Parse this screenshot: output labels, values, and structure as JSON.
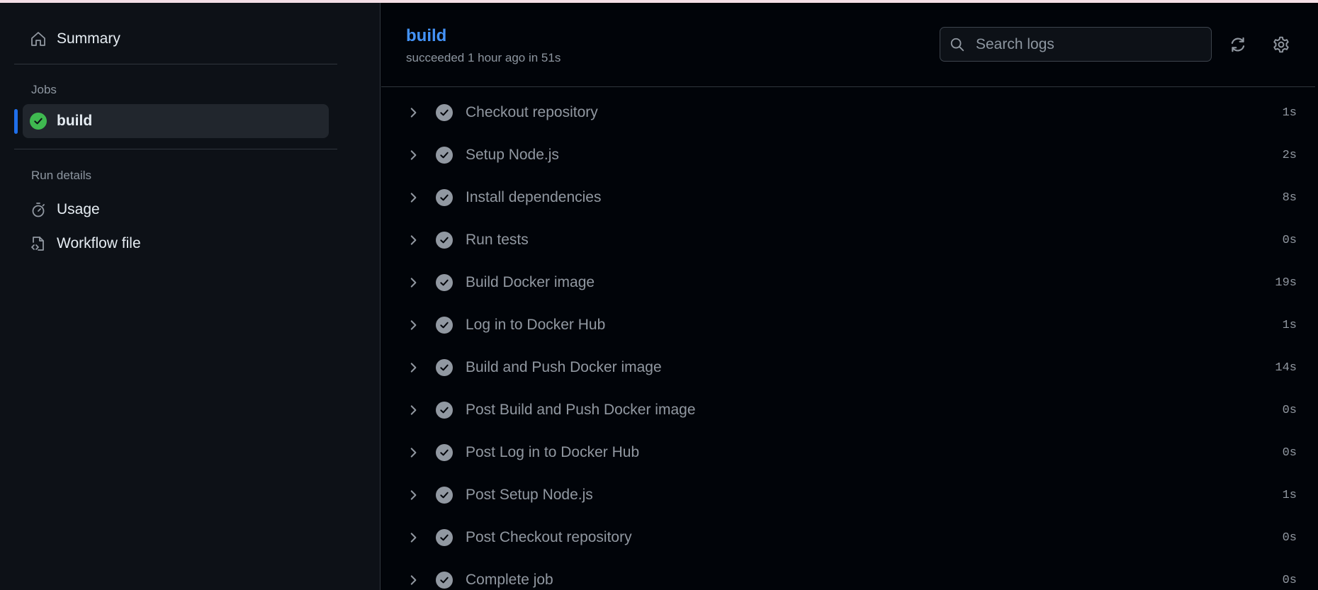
{
  "sidebar": {
    "summary_label": "Summary",
    "jobs_heading": "Jobs",
    "job": {
      "label": "build",
      "status": "success"
    },
    "run_details_heading": "Run details",
    "usage_label": "Usage",
    "workflow_file_label": "Workflow file"
  },
  "header": {
    "title": "build",
    "subtitle": "succeeded 1 hour ago in 51s",
    "search_placeholder": "Search logs"
  },
  "steps": [
    {
      "name": "Checkout repository",
      "duration": "1s"
    },
    {
      "name": "Setup Node.js",
      "duration": "2s"
    },
    {
      "name": "Install dependencies",
      "duration": "8s"
    },
    {
      "name": "Run tests",
      "duration": "0s"
    },
    {
      "name": "Build Docker image",
      "duration": "19s"
    },
    {
      "name": "Log in to Docker Hub",
      "duration": "1s"
    },
    {
      "name": "Build and Push Docker image",
      "duration": "14s"
    },
    {
      "name": "Post Build and Push Docker image",
      "duration": "0s"
    },
    {
      "name": "Post Log in to Docker Hub",
      "duration": "0s"
    },
    {
      "name": "Post Setup Node.js",
      "duration": "1s"
    },
    {
      "name": "Post Checkout repository",
      "duration": "0s"
    },
    {
      "name": "Complete job",
      "duration": "0s"
    }
  ],
  "colors": {
    "accent": "#4493f8",
    "success": "#3fb950",
    "step_done": "#9198a1",
    "active_bar": "#1f6feb"
  }
}
